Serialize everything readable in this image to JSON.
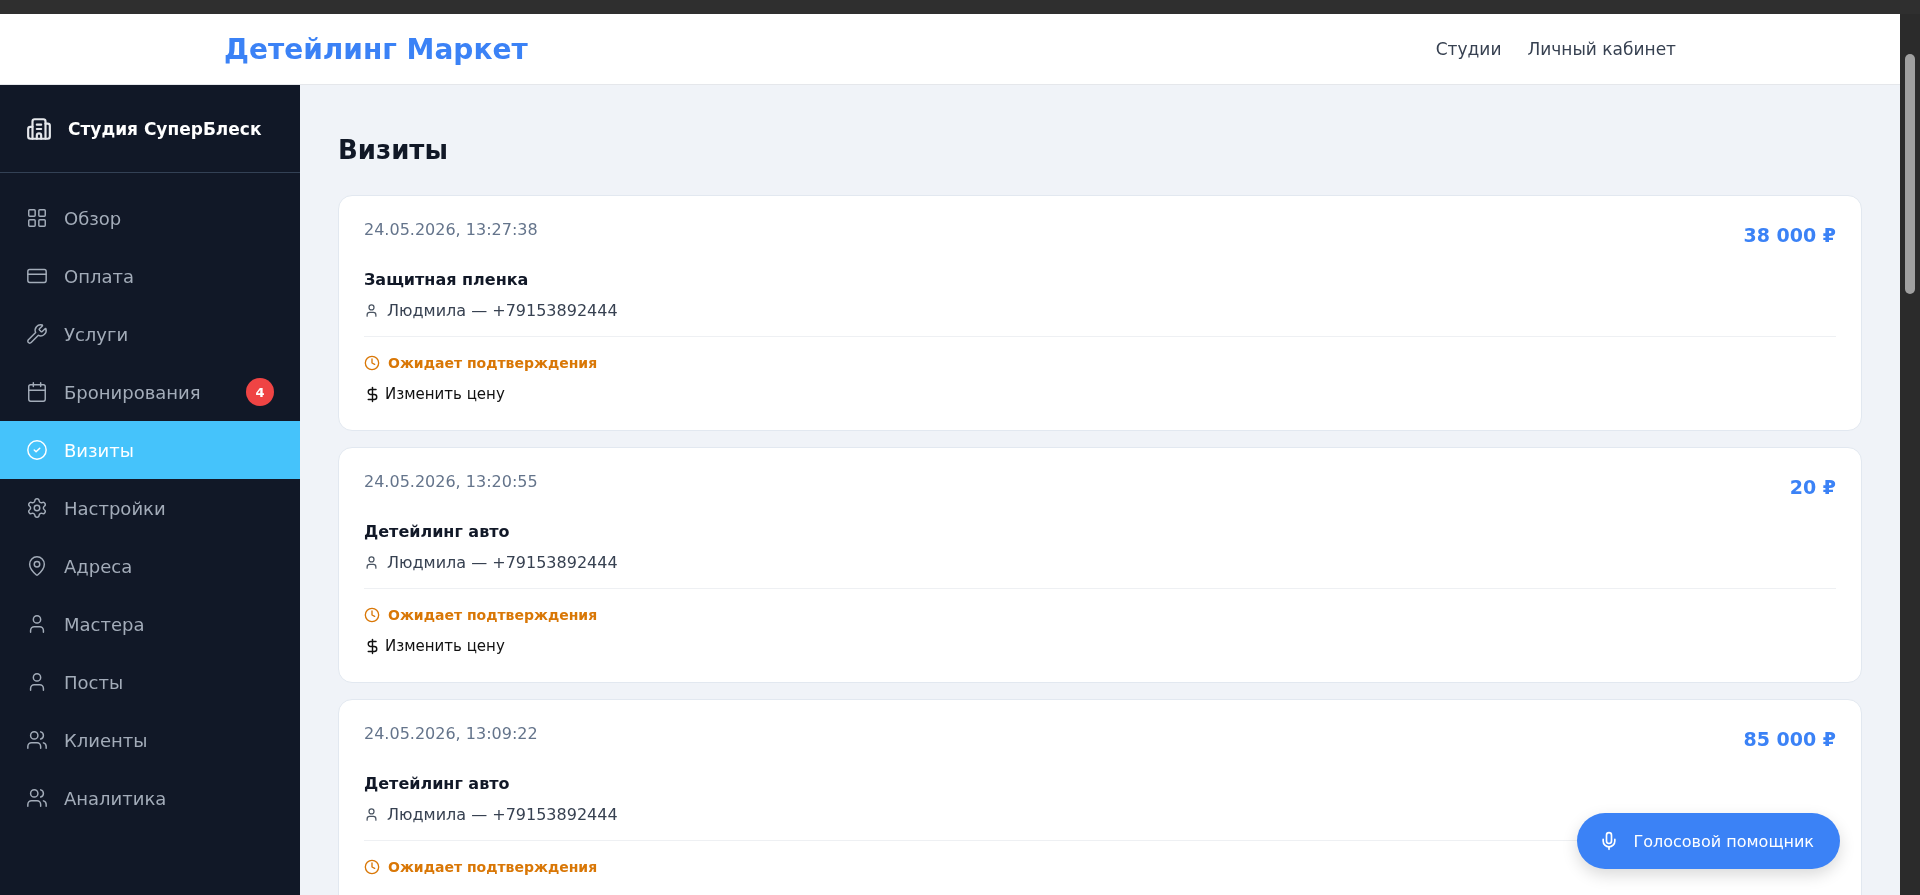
{
  "header": {
    "brand": "Детейлинг Маркет",
    "nav": [
      {
        "label": "Студии"
      },
      {
        "label": "Личный кабинет"
      }
    ]
  },
  "sidebar": {
    "studio": "Студия СуперБлеск",
    "items": [
      {
        "label": "Обзор",
        "selected": false
      },
      {
        "label": "Оплата",
        "selected": false
      },
      {
        "label": "Услуги",
        "selected": false
      },
      {
        "label": "Бронирования",
        "selected": false,
        "badge": "4"
      },
      {
        "label": "Визиты",
        "selected": true
      },
      {
        "label": "Настройки",
        "selected": false
      },
      {
        "label": "Адреса",
        "selected": false
      },
      {
        "label": "Мастера",
        "selected": false
      },
      {
        "label": "Посты",
        "selected": false
      },
      {
        "label": "Клиенты",
        "selected": false
      },
      {
        "label": "Аналитика",
        "selected": false
      }
    ]
  },
  "page": {
    "title": "Визиты"
  },
  "visits": [
    {
      "datetime": "24.05.2026, 13:27:38",
      "price": "38 000 ₽",
      "service": "Защитная пленка",
      "client": "Людмила — +79153892444",
      "status": "Ожидает подтверждения",
      "action": "Изменить цену"
    },
    {
      "datetime": "24.05.2026, 13:20:55",
      "price": "20 ₽",
      "service": "Детейлинг авто",
      "client": "Людмила — +79153892444",
      "status": "Ожидает подтверждения",
      "action": "Изменить цену"
    },
    {
      "datetime": "24.05.2026, 13:09:22",
      "price": "85 000 ₽",
      "service": "Детейлинг авто",
      "client": "Людмила — +79153892444",
      "status": "Ожидает подтверждения"
    }
  ],
  "voice_button": {
    "label": "Голосовой помощник"
  }
}
